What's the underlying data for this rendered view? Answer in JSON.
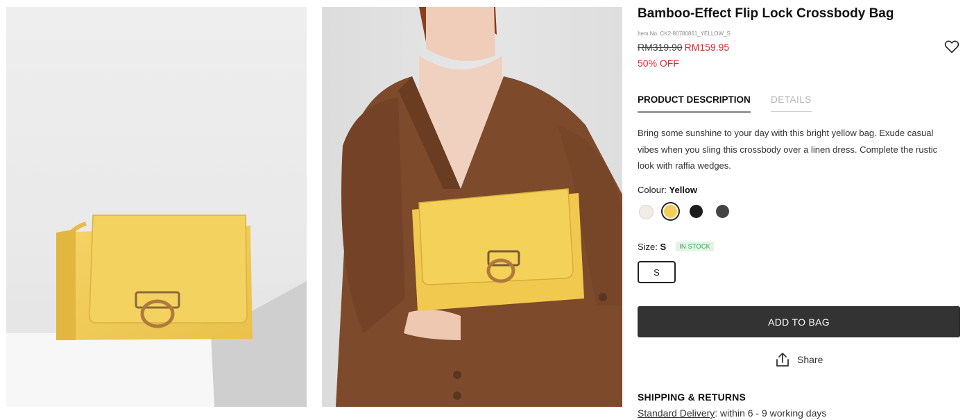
{
  "product": {
    "title": "Bamboo-Effect Flip Lock Crossbody Bag",
    "item_no": "Item No. CK2-80780861_YELLOW_S",
    "price_original": "RM319.90",
    "price_sale": "RM159.95",
    "discount": "50% OFF"
  },
  "tabs": [
    {
      "label": "PRODUCT DESCRIPTION",
      "active": true
    },
    {
      "label": "DETAILS",
      "active": false
    }
  ],
  "description": "Bring some sunshine to your day with this bright yellow bag. Exude casual vibes when you sling this crossbody over a linen dress. Complete the rustic look with raffia wedges.",
  "colour": {
    "label": "Colour:",
    "selected": "Yellow",
    "swatches": [
      {
        "name": "cream",
        "color": "#f1ede6"
      },
      {
        "name": "yellow",
        "color": "#f2cf5b"
      },
      {
        "name": "black",
        "color": "#1c1c1c"
      },
      {
        "name": "dark-grey",
        "color": "#454545"
      }
    ]
  },
  "size": {
    "label": "Size:",
    "selected": "S",
    "stock": "IN STOCK",
    "options": [
      "S"
    ]
  },
  "actions": {
    "add_to_bag": "ADD TO BAG",
    "share": "Share"
  },
  "shipping": {
    "title": "SHIPPING & RETURNS",
    "delivery_link": "Standard Delivery",
    "delivery_text": ": within 6 - 9 working days"
  },
  "colors": {
    "sale_red": "#d9272d",
    "button_dark": "#333333",
    "stock_green": "#3c9a4e"
  },
  "icons": {
    "wishlist": "heart-icon",
    "share": "share-icon"
  }
}
